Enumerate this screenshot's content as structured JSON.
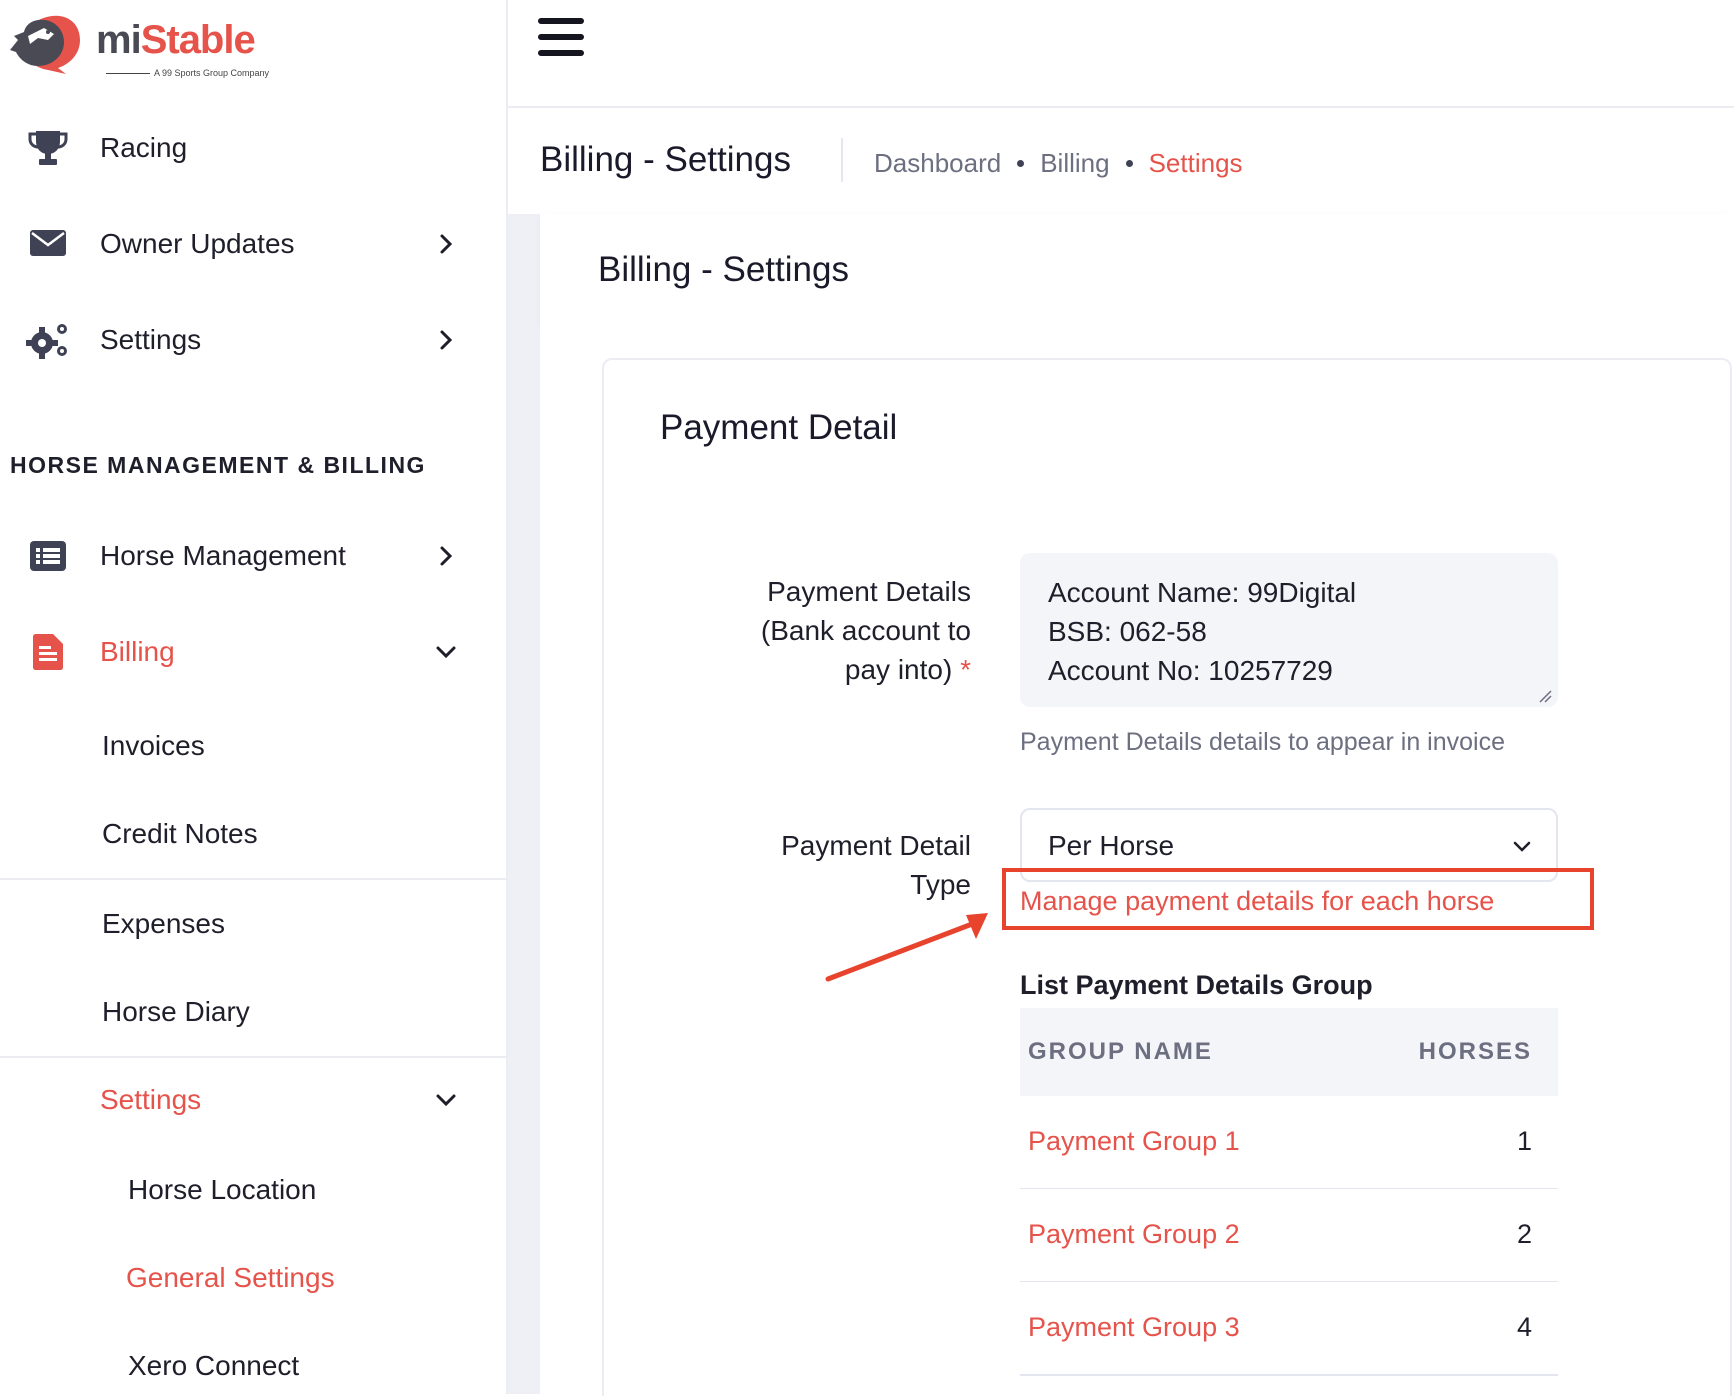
{
  "brand": {
    "name_part1": "mi",
    "name_part2": "Stable",
    "tagline": "A 99 Sports Group Company",
    "accent_color": "#e5534b"
  },
  "sidebar": {
    "items": [
      {
        "label": "Racing",
        "icon": "trophy-icon"
      },
      {
        "label": "Owner Updates",
        "icon": "envelope-icon"
      },
      {
        "label": "Settings",
        "icon": "gears-icon"
      }
    ],
    "section_title": "HORSE MANAGEMENT & BILLING",
    "management_items": [
      {
        "label": "Horse Management",
        "icon": "list-icon"
      },
      {
        "label": "Billing",
        "icon": "document-icon"
      }
    ],
    "billing_sub": [
      {
        "label": "Invoices"
      },
      {
        "label": "Credit Notes"
      },
      {
        "label": "Expenses"
      },
      {
        "label": "Horse Diary"
      }
    ],
    "settings_group": {
      "label": "Settings"
    },
    "settings_sub": [
      {
        "label": "Horse Location"
      },
      {
        "label": "General Settings"
      },
      {
        "label": "Xero Connect"
      }
    ]
  },
  "header": {
    "title": "Billing - Settings",
    "breadcrumb": [
      "Dashboard",
      "Billing",
      "Settings"
    ]
  },
  "card": {
    "title": "Billing - Settings",
    "section": "Payment Detail"
  },
  "form": {
    "payment_details_label": [
      "Payment Details",
      "(Bank account to",
      "pay into)"
    ],
    "required_mark": "*",
    "payment_details_value": [
      "Account Name: 99Digital",
      "BSB: 062-58",
      "Account No: 10257729"
    ],
    "help_text": "Payment Details details to appear in invoice",
    "type_label": [
      "Payment Detail",
      "Type"
    ],
    "type_value": "Per Horse",
    "manage_link": "Manage payment details for each horse"
  },
  "table": {
    "title": "List Payment Details Group",
    "headers": [
      "GROUP NAME",
      "HORSES"
    ],
    "rows": [
      {
        "name": "Payment Group 1",
        "horses": "1"
      },
      {
        "name": "Payment Group 2",
        "horses": "2"
      },
      {
        "name": "Payment Group 3",
        "horses": "4"
      }
    ]
  }
}
